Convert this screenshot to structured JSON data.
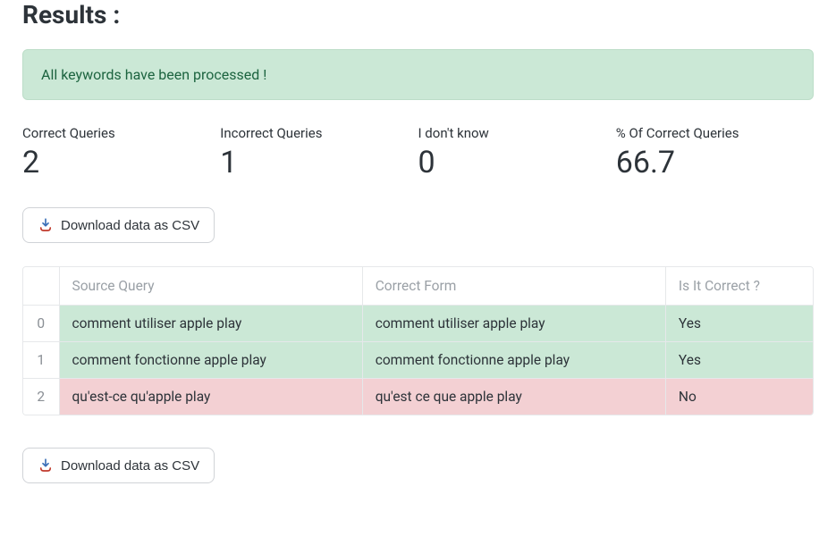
{
  "title": "Results :",
  "alert": "All keywords have been processed !",
  "stats": {
    "correct": {
      "label": "Correct Queries",
      "value": "2"
    },
    "incorrect": {
      "label": "Incorrect Queries",
      "value": "1"
    },
    "unknown": {
      "label": "I don't know",
      "value": "0"
    },
    "percent": {
      "label": "% Of Correct Queries",
      "value": "66.7"
    }
  },
  "download_label": "Download data as CSV",
  "table": {
    "headers": {
      "source": "Source Query",
      "correct_form": "Correct Form",
      "is_correct": "Is It Correct ?"
    },
    "rows": [
      {
        "idx": "0",
        "source": "comment utiliser apple play",
        "correct_form": "comment utiliser apple play",
        "is_correct": "Yes"
      },
      {
        "idx": "1",
        "source": "comment fonctionne apple play",
        "correct_form": "comment fonctionne apple play",
        "is_correct": "Yes"
      },
      {
        "idx": "2",
        "source": "qu'est-ce qu'apple play",
        "correct_form": "qu'est ce que apple play",
        "is_correct": "No"
      }
    ]
  }
}
